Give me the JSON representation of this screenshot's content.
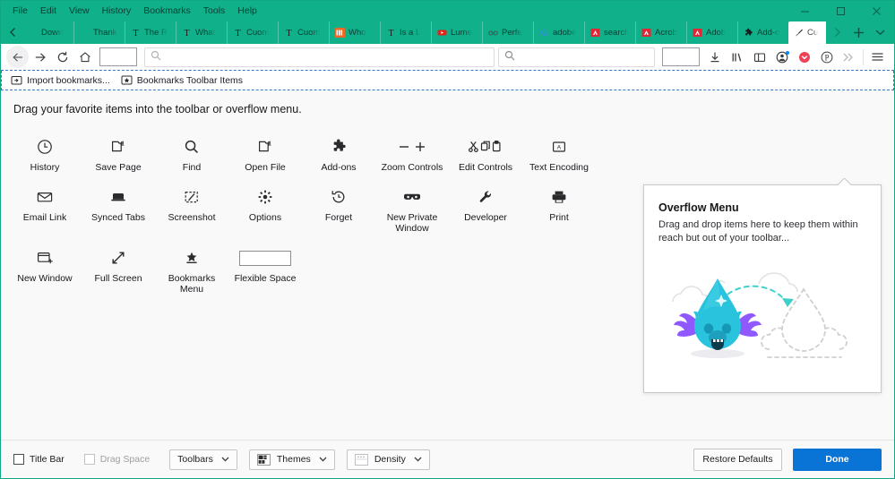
{
  "window": {
    "menu": [
      "File",
      "Edit",
      "View",
      "History",
      "Bookmarks",
      "Tools",
      "Help"
    ],
    "controls": {
      "minimize": "minimize-icon",
      "maximize": "maximize-icon",
      "close": "close-icon"
    },
    "chrome_color": "#0fb08a"
  },
  "tabstrip": {
    "scroll_left": "chevron-left-icon",
    "scroll_right": "chevron-right-icon",
    "new_tab": "plus-icon",
    "list_all_tabs": "chevron-down-icon",
    "tabs": [
      {
        "label": "Down",
        "icon": "blank-favicon",
        "active": false
      },
      {
        "label": "Thank you",
        "icon": "blank-favicon",
        "active": false
      },
      {
        "label": "The R",
        "icon": "nyt-favicon",
        "active": false
      },
      {
        "label": "What",
        "icon": "nyt-favicon",
        "active": false
      },
      {
        "label": "Cuom",
        "icon": "nyt-favicon",
        "active": false
      },
      {
        "label": "Cuom",
        "icon": "nyt-favicon",
        "active": false
      },
      {
        "label": "Who",
        "icon": "nbc-favicon",
        "active": false
      },
      {
        "label": "Is a L",
        "icon": "nyt-favicon",
        "active": false
      },
      {
        "label": "Lume",
        "icon": "youtube-favicon",
        "active": false
      },
      {
        "label": "Perfe",
        "icon": "glasses-favicon",
        "active": false
      },
      {
        "label": "adobe",
        "icon": "google-favicon",
        "active": false
      },
      {
        "label": "search",
        "icon": "adobe-favicon",
        "active": false
      },
      {
        "label": "Acrob",
        "icon": "adobe-favicon",
        "active": false
      },
      {
        "label": "Adob",
        "icon": "adobe-favicon",
        "active": false
      },
      {
        "label": "Add-o",
        "icon": "addons-puzzle-favicon",
        "active": false
      },
      {
        "label": "Cu",
        "icon": "customize-brush-favicon",
        "active": true
      }
    ]
  },
  "navbar": {
    "back": "back-arrow-icon",
    "forward": "forward-arrow-icon",
    "reload": "reload-icon",
    "home": "home-icon",
    "drop_target": "toolbar-drop-slot",
    "url_placeholder": "",
    "url_value": "",
    "url_icon": "magnifier-icon",
    "search_placeholder": "",
    "search_value": "",
    "search_icon": "magnifier-icon",
    "right_icons": [
      "downloads-icon",
      "library-icon",
      "sidebars-icon",
      "account-icon",
      "pocket-icon",
      "pinterest-icon",
      "overflow-chevrons-icon",
      "hamburger-menu-icon"
    ]
  },
  "bookmarks_toolbar": {
    "items": [
      {
        "label": "Import bookmarks...",
        "icon": "import-bookmarks-icon"
      },
      {
        "label": "Bookmarks Toolbar Items",
        "icon": "bookmarks-toolbar-items-icon"
      }
    ]
  },
  "customize": {
    "instruction": "Drag your favorite items into the toolbar or overflow menu.",
    "palette": [
      {
        "label": "History",
        "icon": "clock-icon"
      },
      {
        "label": "Save Page",
        "icon": "save-page-icon"
      },
      {
        "label": "Find",
        "icon": "magnifier-icon"
      },
      {
        "label": "Open File",
        "icon": "open-file-icon"
      },
      {
        "label": "Add-ons",
        "icon": "puzzle-icon"
      },
      {
        "label": "Zoom Controls",
        "icon": "zoom-minus-plus-icon"
      },
      {
        "label": "Edit Controls",
        "icon": "cut-copy-paste-icon"
      },
      {
        "label": "Text Encoding",
        "icon": "text-encoding-icon"
      },
      {
        "label": "Email Link",
        "icon": "envelope-icon"
      },
      {
        "label": "Synced Tabs",
        "icon": "synced-tabs-icon"
      },
      {
        "label": "Screenshot",
        "icon": "screenshot-icon"
      },
      {
        "label": "Options",
        "icon": "gear-icon"
      },
      {
        "label": "Forget",
        "icon": "forget-icon"
      },
      {
        "label": "New Private Window",
        "icon": "private-mask-icon"
      },
      {
        "label": "Developer",
        "icon": "wrench-icon"
      },
      {
        "label": "Print",
        "icon": "printer-icon"
      },
      {
        "label": "New Window",
        "icon": "new-window-icon"
      },
      {
        "label": "Full Screen",
        "icon": "fullscreen-arrows-icon"
      },
      {
        "label": "Bookmarks Menu",
        "icon": "bookmarks-star-icon"
      },
      {
        "label": "Flexible Space",
        "icon": "flexible-space-box"
      }
    ]
  },
  "overflow_panel": {
    "title": "Overflow Menu",
    "description": "Drag and drop items here to keep them within reach but out of your toolbar...",
    "illustration": "fox-drag-drop-illustration"
  },
  "bottombar": {
    "title_bar": {
      "label": "Title Bar",
      "checked": false,
      "disabled": false
    },
    "drag_space": {
      "label": "Drag Space",
      "checked": false,
      "disabled": true
    },
    "toolbars": {
      "label": "Toolbars",
      "caret": "chevron-down-icon"
    },
    "themes": {
      "label": "Themes",
      "icon": "themes-swatch-icon",
      "caret": "chevron-down-icon"
    },
    "density": {
      "label": "Density",
      "icon": "density-icon",
      "caret": "chevron-down-icon"
    },
    "restore_defaults": "Restore Defaults",
    "done": "Done",
    "done_color": "#0a73d6"
  }
}
